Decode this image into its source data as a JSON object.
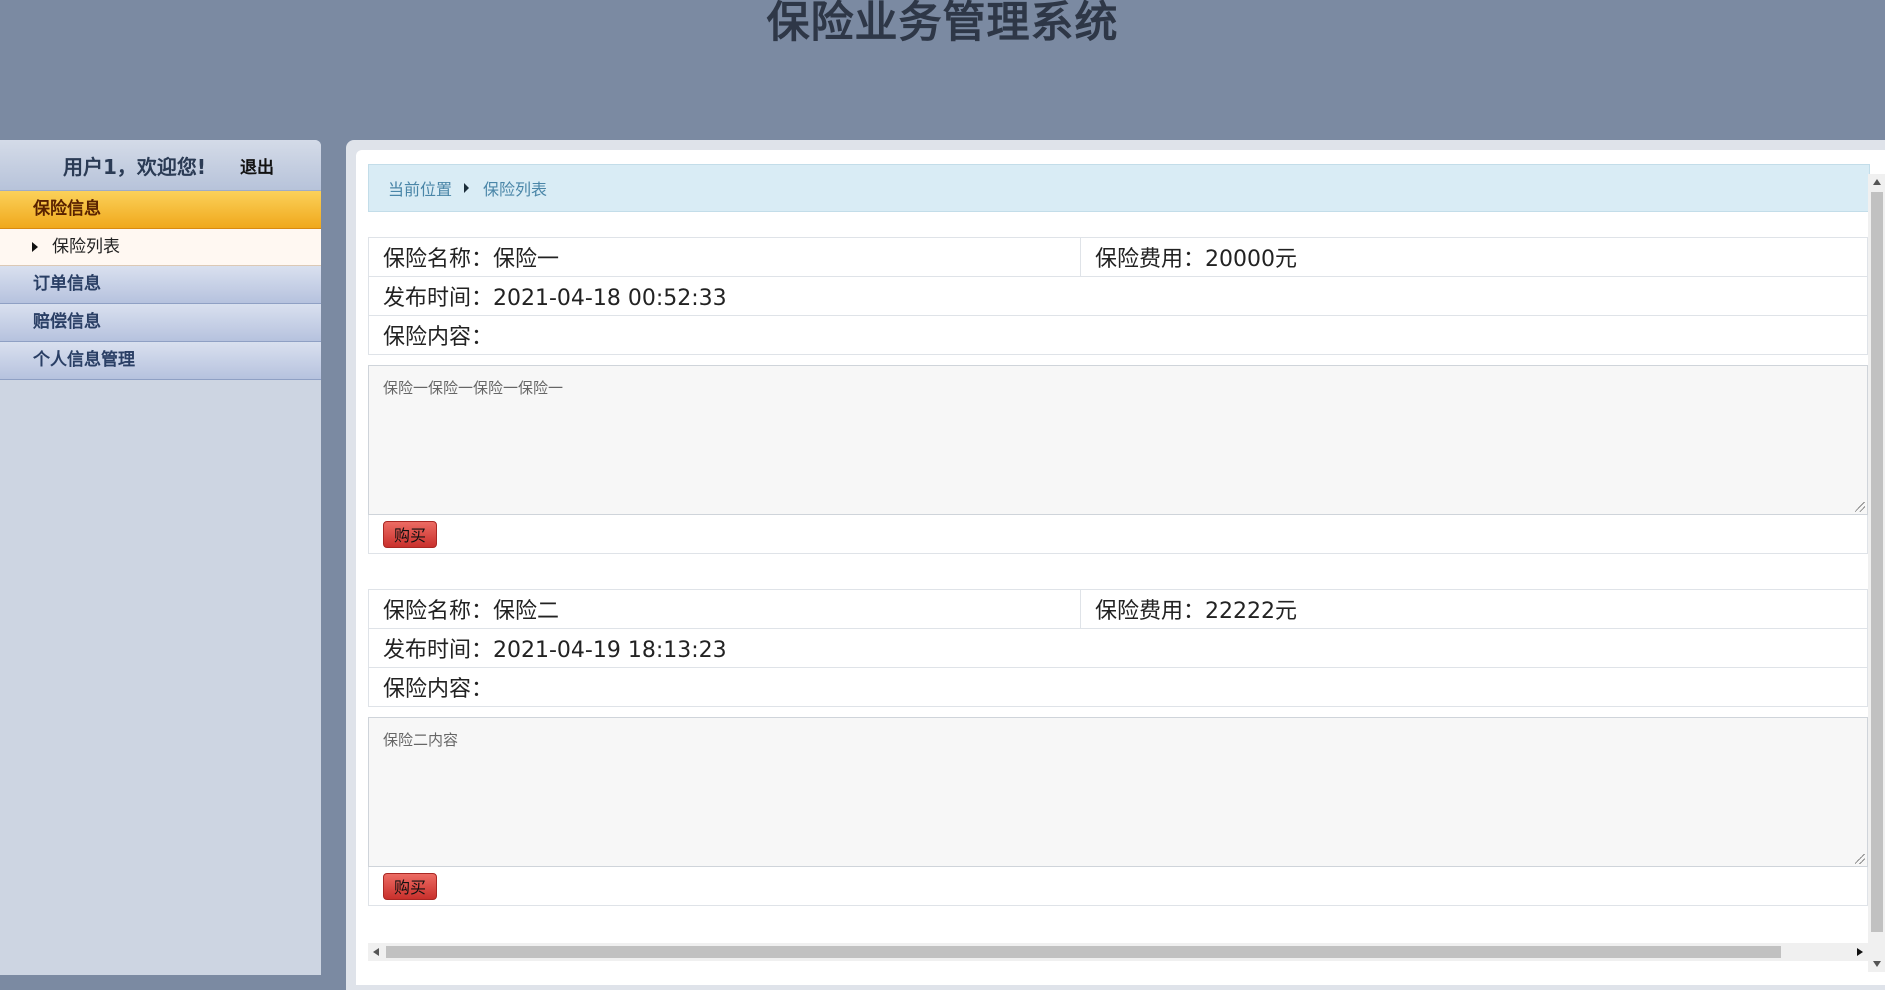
{
  "app_title": "保险业务管理系统",
  "sidebar": {
    "user_greeting": "用户1，欢迎您!",
    "logout_label": "退出",
    "categories": [
      {
        "label": "保险信息",
        "active": true,
        "sub_items": [
          {
            "label": "保险列表"
          }
        ]
      },
      {
        "label": "订单信息"
      },
      {
        "label": "赔偿信息"
      },
      {
        "label": "个人信息管理"
      }
    ]
  },
  "breadcrumb": {
    "home": "当前位置",
    "current": "保险列表"
  },
  "insurances": [
    {
      "name_label": "保险名称：保险一",
      "fee_label": "保险费用：20000元",
      "time_label": "发布时间：2021-04-18 00:52:33",
      "content_label": "保险内容：",
      "content": "保险一保险一保险一保险一",
      "buy_label": "购买"
    },
    {
      "name_label": "保险名称：保险二",
      "fee_label": "保险费用：22222元",
      "time_label": "发布时间：2021-04-19 18:13:23",
      "content_label": "保险内容：",
      "content": "保险二内容",
      "buy_label": "购买"
    }
  ],
  "colors": {
    "header_bg": "#7b8aa2",
    "active_category": "#f0a81c",
    "buy_button": "#c9302c"
  }
}
